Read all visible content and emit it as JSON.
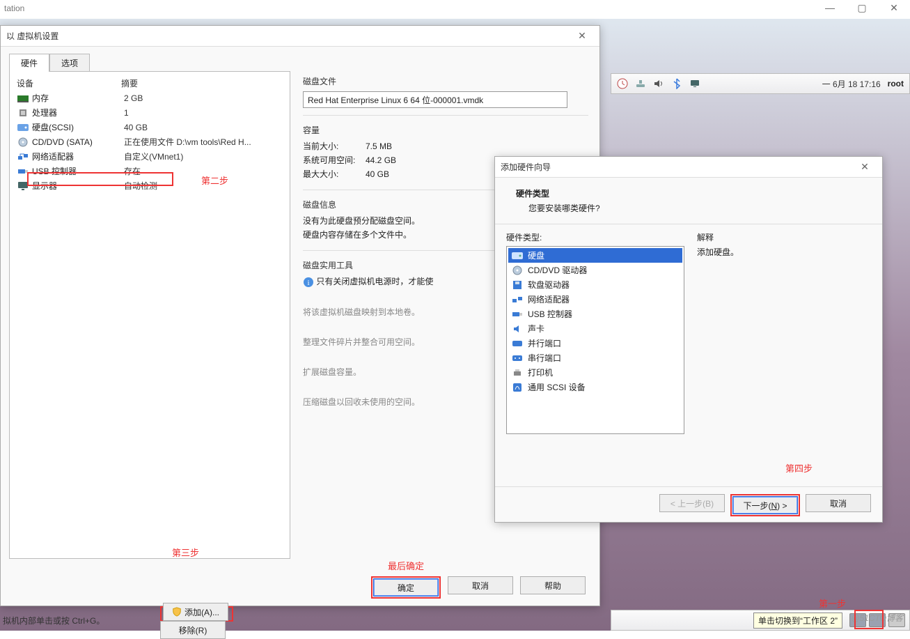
{
  "app": {
    "title": "tation",
    "hint": "拟机内部单击或按 Ctrl+G。",
    "watermark": "@51CTO博客"
  },
  "guest_panel": {
    "date": "一 6月 18 17:16",
    "user": "root"
  },
  "guest_taskbar": {
    "tooltip": "单击切换到“工作区 2”"
  },
  "settings_dialog": {
    "title": "以 虚拟机设置",
    "tabs": {
      "hardware": "硬件",
      "options": "选项"
    },
    "list_header": {
      "device": "设备",
      "summary": "摘要"
    },
    "devices": [
      {
        "icon": "memory",
        "name": "内存",
        "summary": "2 GB"
      },
      {
        "icon": "cpu",
        "name": "处理器",
        "summary": "1"
      },
      {
        "icon": "disk",
        "name": "硬盘(SCSI)",
        "summary": "40 GB"
      },
      {
        "icon": "cd",
        "name": "CD/DVD (SATA)",
        "summary": "正在使用文件 D:\\vm  tools\\Red H..."
      },
      {
        "icon": "net",
        "name": "网络适配器",
        "summary": "自定义(VMnet1)"
      },
      {
        "icon": "usb",
        "name": "USB 控制器",
        "summary": "存在"
      },
      {
        "icon": "display",
        "name": "显示器",
        "summary": "自动检测"
      }
    ],
    "step2": "第二步",
    "step3": "第三步",
    "add_btn": "添加(A)...",
    "remove_btn": "移除(R)",
    "right": {
      "disk_file_label": "磁盘文件",
      "disk_file_value": "Red Hat Enterprise Linux 6 64 位-000001.vmdk",
      "capacity_label": "容量",
      "current_size_k": "当前大小:",
      "current_size_v": "7.5 MB",
      "free_space_k": "系统可用空间:",
      "free_space_v": "44.2 GB",
      "max_size_k": "最大大小:",
      "max_size_v": "40 GB",
      "disk_info_label": "磁盘信息",
      "disk_info_1": "没有为此硬盘预分配磁盘空间。",
      "disk_info_2": "硬盘内容存储在多个文件中。",
      "util_label": "磁盘实用工具",
      "util_info": "只有关闭虚拟机电源时，才能使",
      "util_gray1": "将该虚拟机磁盘映射到本地卷。",
      "util_gray2": "整理文件碎片并整合可用空间。",
      "util_gray3": "扩展磁盘容量。",
      "util_gray4": "压缩磁盘以回收未使用的空间。"
    },
    "confirm_label": "最后确定",
    "ok": "确定",
    "cancel": "取消",
    "help": "帮助"
  },
  "wizard": {
    "title": "添加硬件向导",
    "h1": "硬件类型",
    "h2": "您要安装哪类硬件?",
    "left_label": "硬件类型:",
    "right_label": "解释",
    "right_desc": "添加硬盘。",
    "types": [
      {
        "icon": "disk",
        "name": "硬盘",
        "selected": true
      },
      {
        "icon": "cd",
        "name": "CD/DVD 驱动器"
      },
      {
        "icon": "floppy",
        "name": "软盘驱动器"
      },
      {
        "icon": "net",
        "name": "网络适配器"
      },
      {
        "icon": "usb",
        "name": "USB 控制器"
      },
      {
        "icon": "sound",
        "name": "声卡"
      },
      {
        "icon": "parallel",
        "name": "并行端口"
      },
      {
        "icon": "serial",
        "name": "串行端口"
      },
      {
        "icon": "printer",
        "name": "打印机"
      },
      {
        "icon": "scsi",
        "name": "通用 SCSI 设备"
      }
    ],
    "step4": "第四步",
    "back": "< 上一步(B)",
    "next": "下一步(N) >",
    "cancel": "取消"
  },
  "step1": "第一步"
}
